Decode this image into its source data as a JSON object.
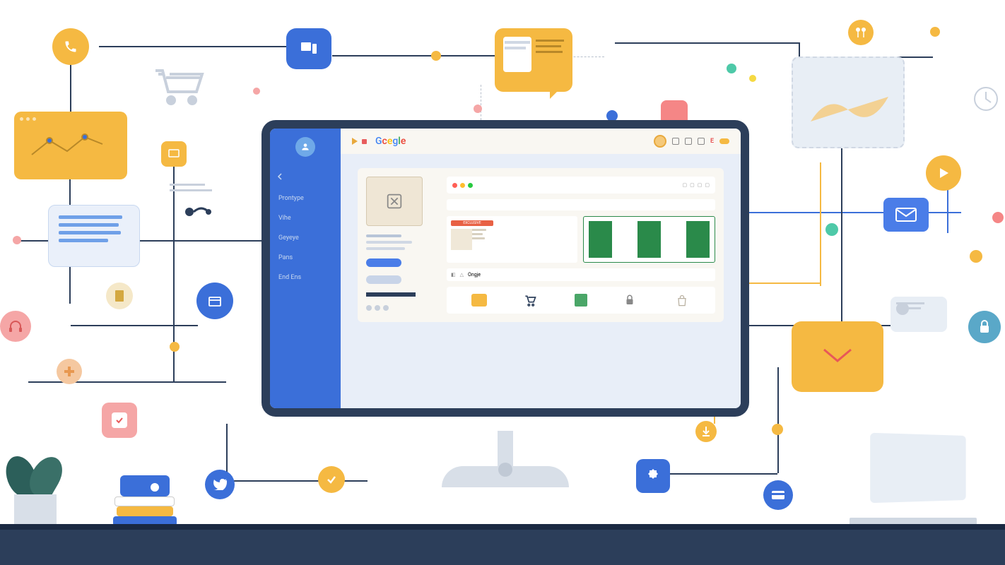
{
  "sidebar": {
    "items": [
      {
        "label": "Prontype"
      },
      {
        "label": "Vihe"
      },
      {
        "label": "Geyeye"
      },
      {
        "label": "Pans"
      },
      {
        "label": "End Ens"
      }
    ]
  },
  "brand": {
    "text": "Gcegle"
  },
  "inner_window": {
    "header_text": "EXCLUSIVE",
    "logo_text": "Ongje"
  },
  "floating_icons": {
    "phone": "phone-icon",
    "cart": "cart-icon",
    "mail": "mail-icon",
    "lock": "lock-icon",
    "play": "play-icon",
    "chat": "chat-icon",
    "checkbox": "checkbox-icon",
    "gear": "gear-icon",
    "twitter": "twitter-icon",
    "at": "at-icon",
    "doc": "document-icon",
    "card": "card-icon"
  }
}
